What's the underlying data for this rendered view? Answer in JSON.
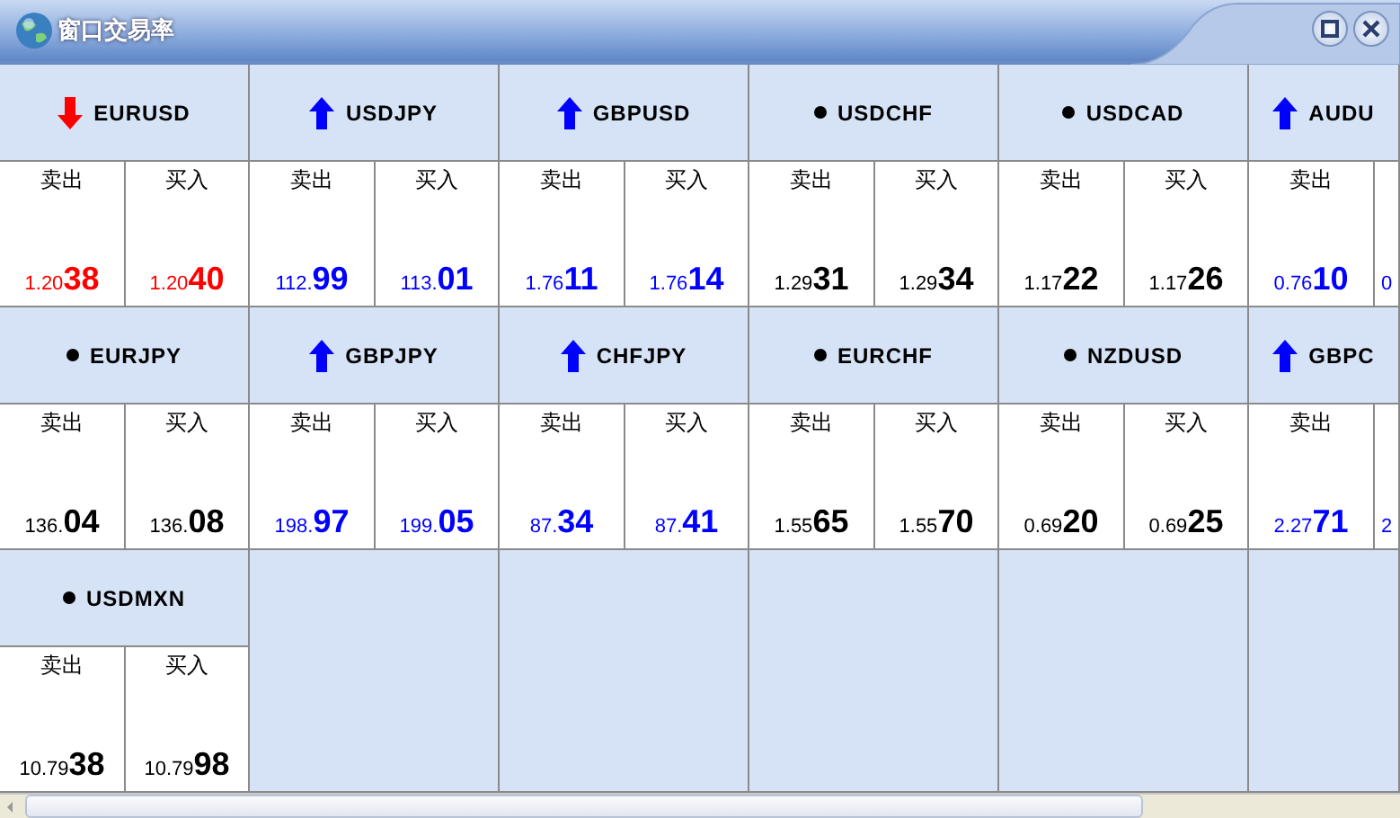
{
  "window": {
    "title": "窗口交易率"
  },
  "rows": [
    [
      {
        "symbol": "EURUSD",
        "kind": "down",
        "quotes": [
          {
            "label": "卖出",
            "small": "1.20",
            "big": "38"
          },
          {
            "label": "买入",
            "small": "1.20",
            "big": "40"
          }
        ]
      },
      {
        "symbol": "USDJPY",
        "kind": "up",
        "quotes": [
          {
            "label": "卖出",
            "small": "112.",
            "big": "99"
          },
          {
            "label": "买入",
            "small": "113.",
            "big": "01"
          }
        ]
      },
      {
        "symbol": "GBPUSD",
        "kind": "up",
        "quotes": [
          {
            "label": "卖出",
            "small": "1.76",
            "big": "11"
          },
          {
            "label": "买入",
            "small": "1.76",
            "big": "14"
          }
        ]
      },
      {
        "symbol": "USDCHF",
        "kind": "flat",
        "quotes": [
          {
            "label": "卖出",
            "small": "1.29",
            "big": "31"
          },
          {
            "label": "买入",
            "small": "1.29",
            "big": "34"
          }
        ]
      },
      {
        "symbol": "USDCAD",
        "kind": "flat",
        "quotes": [
          {
            "label": "卖出",
            "small": "1.17",
            "big": "22"
          },
          {
            "label": "买入",
            "small": "1.17",
            "big": "26"
          }
        ]
      },
      {
        "symbol": "AUDU",
        "kind": "up",
        "quotes": [
          {
            "label": "卖出",
            "small": "0.76",
            "big": "10"
          },
          {
            "small": "0"
          }
        ]
      }
    ],
    [
      {
        "symbol": "EURJPY",
        "kind": "flat",
        "quotes": [
          {
            "label": "卖出",
            "small": "136.",
            "big": "04"
          },
          {
            "label": "买入",
            "small": "136.",
            "big": "08"
          }
        ]
      },
      {
        "symbol": "GBPJPY",
        "kind": "up",
        "quotes": [
          {
            "label": "卖出",
            "small": "198.",
            "big": "97"
          },
          {
            "label": "买入",
            "small": "199.",
            "big": "05"
          }
        ]
      },
      {
        "symbol": "CHFJPY",
        "kind": "up",
        "quotes": [
          {
            "label": "卖出",
            "small": "87.",
            "big": "34"
          },
          {
            "label": "买入",
            "small": "87.",
            "big": "41"
          }
        ]
      },
      {
        "symbol": "EURCHF",
        "kind": "flat",
        "quotes": [
          {
            "label": "卖出",
            "small": "1.55",
            "big": "65"
          },
          {
            "label": "买入",
            "small": "1.55",
            "big": "70"
          }
        ]
      },
      {
        "symbol": "NZDUSD",
        "kind": "flat",
        "quotes": [
          {
            "label": "卖出",
            "small": "0.69",
            "big": "20"
          },
          {
            "label": "买入",
            "small": "0.69",
            "big": "25"
          }
        ]
      },
      {
        "symbol": "GBPC",
        "kind": "up",
        "quotes": [
          {
            "label": "卖出",
            "small": "2.27",
            "big": "71"
          },
          {
            "small": "2"
          }
        ]
      }
    ],
    [
      {
        "symbol": "USDMXN",
        "kind": "flat",
        "quotes": [
          {
            "label": "卖出",
            "small": "10.79",
            "big": "38"
          },
          {
            "label": "买入",
            "small": "10.79",
            "big": "98"
          }
        ]
      }
    ]
  ]
}
